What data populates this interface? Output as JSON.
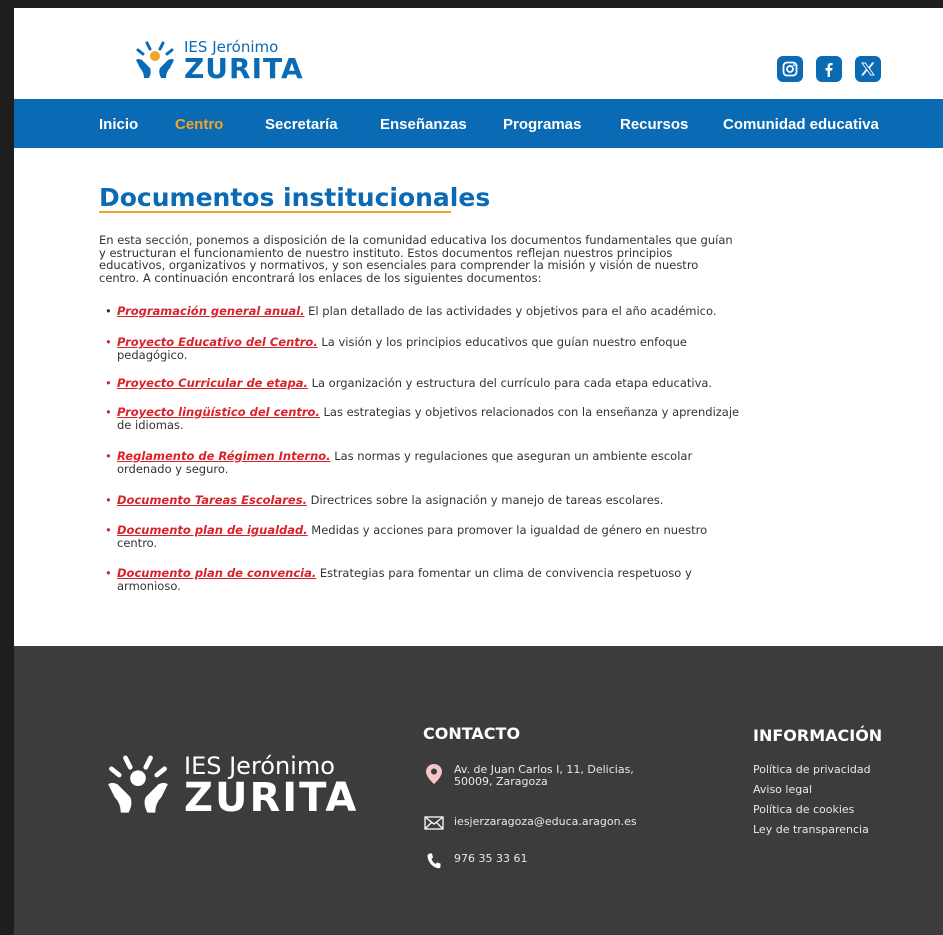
{
  "brand": {
    "sub": "IES Jerónimo",
    "main": "ZURITA",
    "primary_color": "#0a6ab4",
    "accent_color": "#f0a52a",
    "link_color": "#d8232a"
  },
  "social": [
    {
      "name": "instagram-icon"
    },
    {
      "name": "facebook-icon"
    },
    {
      "name": "x-icon"
    }
  ],
  "nav": {
    "items": [
      {
        "label": "Inicio",
        "active": false
      },
      {
        "label": "Centro",
        "active": true
      },
      {
        "label": "Secretaría",
        "active": false
      },
      {
        "label": "Enseñanzas",
        "active": false
      },
      {
        "label": "Programas",
        "active": false
      },
      {
        "label": "Recursos",
        "active": false
      },
      {
        "label": "Comunidad educativa",
        "active": false
      }
    ]
  },
  "main": {
    "title": "Documentos institucionales",
    "intro": "En esta sección, ponemos a disposición de la comunidad educativa los documentos fundamentales que guían y estructuran el funcionamiento de nuestro instituto. Estos documentos reflejan nuestros principios educativos, organizativos y normativos, y son esenciales para comprender la misión y visión de nuestro centro. A continuación encontrará los enlaces de los siguientes documentos:",
    "documents": [
      {
        "link": "Programación general anual.",
        "desc": " El plan detallado de las actividades y objetivos para el año académico."
      },
      {
        "link": "Proyecto Educativo del Centro.",
        "desc": " La visión y los principios educativos que guían nuestro enfoque pedagógico."
      },
      {
        "link": "Proyecto Curricular de etapa.",
        "desc": " La organización y estructura del currículo para cada etapa educativa."
      },
      {
        "link": "Proyecto lingüístico del centro.",
        "desc": " Las estrategias y objetivos relacionados con la enseñanza y aprendizaje de idiomas."
      },
      {
        "link": "Reglamento de Régimen Interno.",
        "desc": " Las normas y regulaciones que aseguran un ambiente escolar ordenado y seguro."
      },
      {
        "link": "Documento Tareas Escolares.",
        "desc": " Directrices sobre la asignación y manejo de tareas escolares."
      },
      {
        "link": "Documento plan de igualdad.",
        "desc": " Medidas y acciones para promover la igualdad de género en nuestro centro."
      },
      {
        "link": "Documento plan de convencia.",
        "desc": " Estrategias para fomentar un clima de convivencia respetuoso y armonioso."
      }
    ]
  },
  "footer": {
    "contact_heading": "CONTACTO",
    "address_line1": "Av. de Juan Carlos I, 11, Delicias,",
    "address_line2": "50009, Zaragoza",
    "email": "iesjerzaragoza@educa.aragon.es",
    "phone": "976 35 33 61",
    "info_heading": "INFORMACIÓN",
    "info_links": [
      "Política de privacidad",
      "Aviso legal",
      "Política de cookies",
      "Ley de transparencia"
    ]
  }
}
